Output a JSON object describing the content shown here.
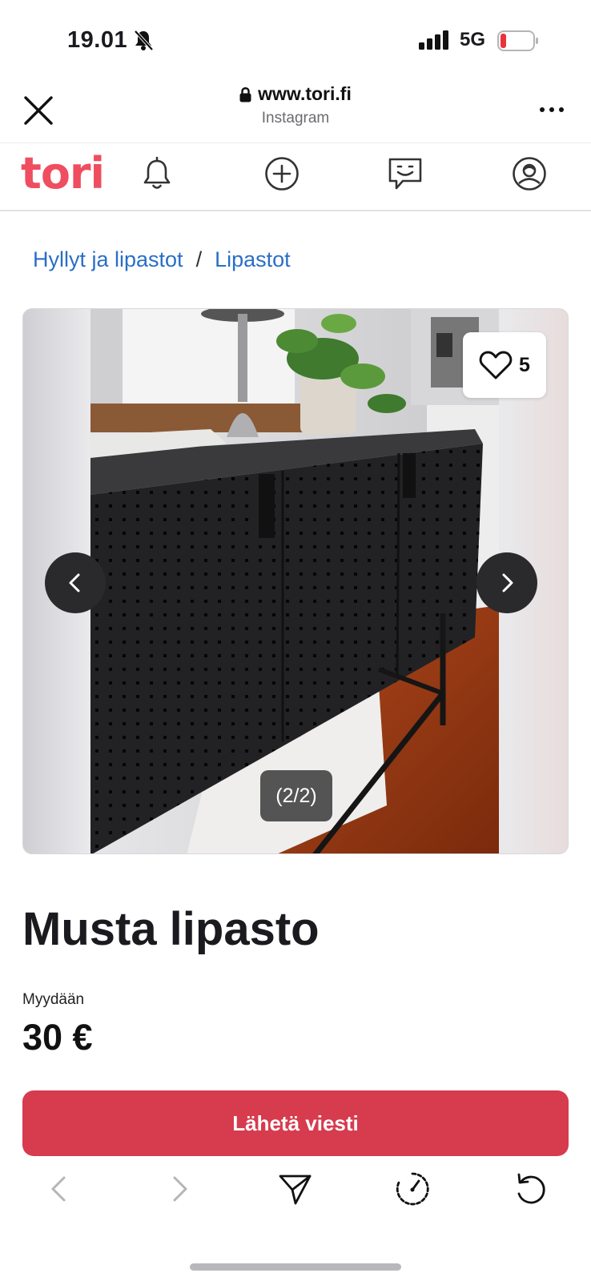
{
  "status": {
    "time": "19.01",
    "network": "5G"
  },
  "browser": {
    "url": "www.tori.fi",
    "subtitle": "Instagram"
  },
  "site": {
    "logo_text": "tori",
    "brand_color": "#ee4e5f"
  },
  "breadcrumb": {
    "items": [
      "Hyllyt ja lipastot",
      "Lipastot"
    ],
    "separator": "/"
  },
  "gallery": {
    "favorite_count": "5",
    "counter": "(2/2)"
  },
  "listing": {
    "title": "Musta lipasto",
    "sale_type": "Myydään",
    "price": "30 €"
  },
  "actions": {
    "send_message": "Lähetä viesti",
    "button_color": "#d63b4e"
  }
}
